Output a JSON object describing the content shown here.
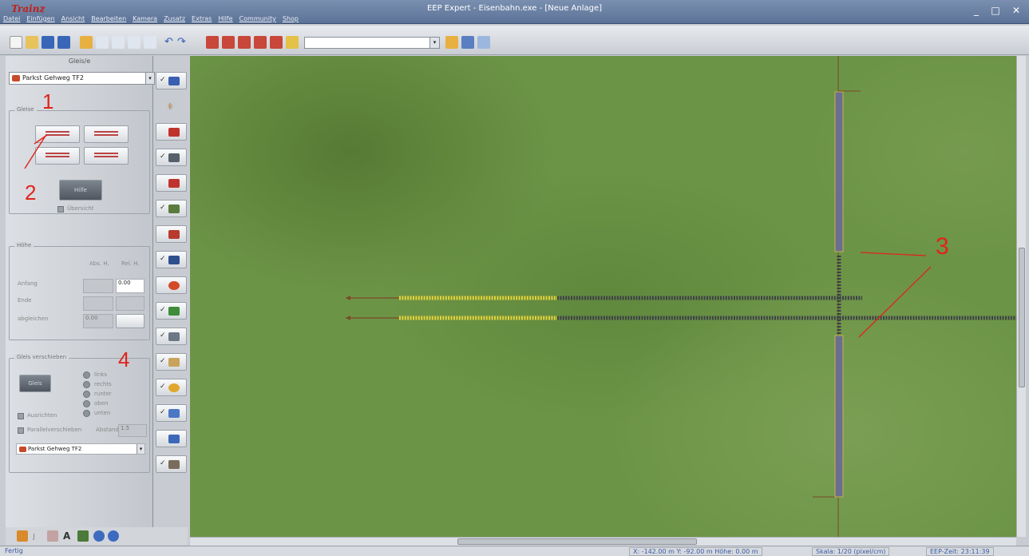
{
  "window": {
    "logo": "Trainz",
    "title": "EEP Expert - Eisenbahn.exe - [Neue Anlage]",
    "controls": [
      "_",
      "□",
      "✕"
    ]
  },
  "menu": [
    "Datei",
    "Einfügen",
    "Ansicht",
    "Bearbeiten",
    "Kamera",
    "Zusatz",
    "Extras",
    "Hilfe",
    "Community",
    "Shop"
  ],
  "toolbar": {
    "combo_value": ""
  },
  "panel": {
    "title": "Gleis/e",
    "selected_object": "Parkst Gehweg TF2",
    "group_gleise": "Gleise",
    "help_label": "Hilfe",
    "check_label": "Übersicht",
    "group_hoehe": "Höhe",
    "col_abs": "Abs. H.",
    "col_rel": "Rel. H.",
    "row_anfang": "Anfang",
    "row_ende": "Ende",
    "row_abgleich": "abgleichen",
    "value_rel_start": "0.00",
    "value_abs_third": "0.00",
    "group_stile": "Gleis verschieben",
    "move_button": "Gleis",
    "radios": [
      "links",
      "rechts",
      "runter",
      "oben",
      "unten"
    ],
    "check_ausrichten": "Ausrichten",
    "check_parallel": "Parallelverschieben",
    "abstand_label": "Abstand",
    "abstand_value": "1.5",
    "lower_select": "Parkst Gehweg TF2"
  },
  "annotations": [
    "1",
    "2",
    "3",
    "4"
  ],
  "statusbar": {
    "left": "Fertig",
    "coords": "X: -142.00 m  Y: -92.00 m  Höhe: 0.00 m",
    "scale": "Skala: 1/20 (pixel/cm)",
    "time": "EEP-Zeit: 23:11:39"
  },
  "colors": {
    "grass": "#6c9446",
    "titlebar": "#5c7398",
    "annotation": "#e0241a",
    "track_yellow": "#e6d23a",
    "track_dark": "#3e4048",
    "road": "#6e6e8e"
  }
}
